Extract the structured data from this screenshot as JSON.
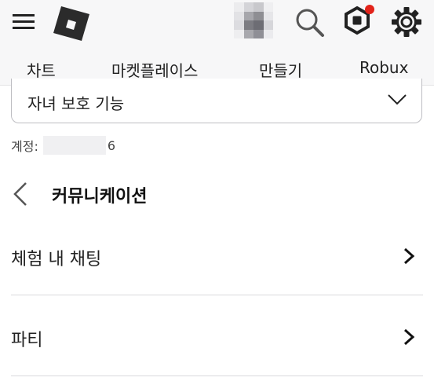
{
  "header": {
    "icons": [
      "menu-icon",
      "roblox-logo-icon",
      "avatar-icon",
      "search-icon",
      "robux-icon",
      "gear-icon"
    ],
    "notification_color": "#e2231a"
  },
  "nav": {
    "tabs": [
      {
        "label": "차트"
      },
      {
        "label": "마켓플레이스"
      },
      {
        "label": "만들기"
      },
      {
        "label": "Robux"
      }
    ]
  },
  "dropdown": {
    "selected": "자녀 보호 기능"
  },
  "account": {
    "label": "계정:",
    "suffix": "6"
  },
  "section": {
    "title": "커뮤니케이션"
  },
  "rows": [
    {
      "label": "체험 내 채팅"
    },
    {
      "label": "파티"
    }
  ]
}
